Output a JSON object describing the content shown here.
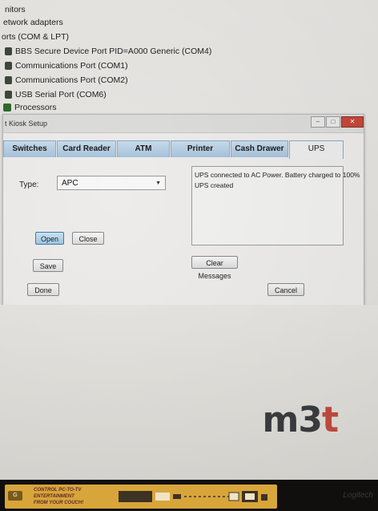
{
  "device_manager": {
    "items": [
      {
        "label": "nitors",
        "indent": 0
      },
      {
        "label": "etwork adapters",
        "indent": 0
      },
      {
        "label": "orts (COM & LPT)",
        "indent": 0
      },
      {
        "label": "BBS Secure Device Port PID=A000 Generic (COM4)",
        "indent": 1
      },
      {
        "label": "Communications Port (COM1)",
        "indent": 1
      },
      {
        "label": "Communications Port (COM2)",
        "indent": 1
      },
      {
        "label": "USB Serial Port (COM6)",
        "indent": 1
      },
      {
        "label": "Processors",
        "indent": 0
      }
    ]
  },
  "kiosk": {
    "title": "t Kiosk Setup",
    "tabs": [
      "Switches",
      "Card Reader",
      "ATM",
      "Printer",
      "Cash Drawer",
      "UPS"
    ],
    "active_tab": "UPS",
    "type_label": "Type:",
    "type_value": "APC",
    "open_label": "Open",
    "close_label": "Close",
    "save_label": "Save",
    "messages": [
      "UPS connected to AC Power.  Battery charged to 100%",
      "UPS created"
    ],
    "clear_messages_label": "Clear Messages",
    "done_label": "Done",
    "cancel_label": "Cancel"
  },
  "logo": {
    "main": "m3",
    "accent": "t"
  },
  "promo": {
    "badge": "G",
    "lines": [
      "CONTROL PC-TO-TV",
      "ENTERTAINMENT",
      "FROM YOUR COUCH!"
    ]
  },
  "brand": "Logitech",
  "colors": {
    "tab_active": "#ededed",
    "tab_inactive": "#b7cfe3",
    "logo_accent": "#c24a40",
    "promo_bg": "#d8a53a"
  }
}
